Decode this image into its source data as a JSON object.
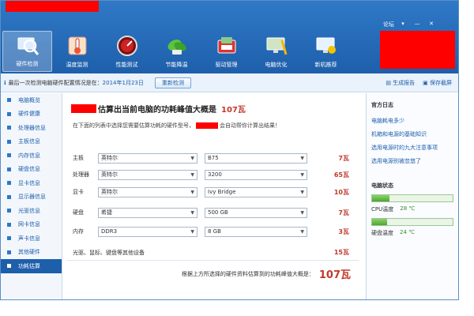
{
  "header": {
    "win_controls": [
      "论坛",
      "▾",
      "—",
      "✕"
    ],
    "toolbar": [
      {
        "label": "硬件检测",
        "icon": "magnifier-computer-icon",
        "active": true
      },
      {
        "label": "温度监测",
        "icon": "thermometer-icon"
      },
      {
        "label": "性能测试",
        "icon": "speed-gauge-icon"
      },
      {
        "label": "节能降温",
        "icon": "leaf-plug-icon"
      },
      {
        "label": "驱动管理",
        "icon": "driver-chip-icon"
      },
      {
        "label": "电脑优化",
        "icon": "monitor-broom-icon"
      },
      {
        "label": "新机推荐",
        "icon": "new-computer-icon"
      }
    ]
  },
  "infobar": {
    "text": "最后一次检测电脑硬件配置情况是在：",
    "date": "2014年1月23日",
    "detect_button": "重新检测",
    "report_link": "生成报告",
    "save_link": "保存截屏"
  },
  "sidebar": {
    "items": [
      {
        "label": "电脑概览"
      },
      {
        "label": "硬件健康"
      },
      {
        "label": "处理器信息"
      },
      {
        "label": "主板信息"
      },
      {
        "label": "内存信息"
      },
      {
        "label": "硬盘信息"
      },
      {
        "label": "显卡信息"
      },
      {
        "label": "显示器信息"
      },
      {
        "label": "光驱信息"
      },
      {
        "label": "网卡信息"
      },
      {
        "label": "声卡信息"
      },
      {
        "label": "其他硬件"
      },
      {
        "label": "功耗估算",
        "active": true
      }
    ]
  },
  "main": {
    "title": "估算出当前电脑的功耗峰值大概是",
    "title_watt": "107瓦",
    "desc_a": "在下面的列表中选择您需要估算功耗的硬件型号，",
    "desc_b": "会自动帮你计算出结果！",
    "rows": [
      {
        "label": "主板",
        "brand": "英特尔",
        "model": "B75",
        "watt": "7瓦"
      },
      {
        "label": "处理器",
        "brand": "英特尔",
        "model": "3200",
        "watt": "65瓦"
      },
      {
        "label": "显卡",
        "brand": "英特尔",
        "model": "Ivy Bridge",
        "watt": "10瓦"
      },
      {
        "label": "硬盘",
        "brand": "希捷",
        "model": "500 GB",
        "watt": "7瓦"
      },
      {
        "label": "内存",
        "brand": "DDR3",
        "model": "8 GB",
        "watt": "3瓦"
      }
    ],
    "other_text": "光驱、鼠标、键盘等其他设备",
    "other_watt": "15瓦",
    "total_text": "根据上方所选择的硬件资料估算到的功耗峰值大概是：",
    "total_watt": "107瓦"
  },
  "rightpanel": {
    "log_title": "官方日志",
    "links": [
      "电脑耗电多少",
      "机箱和电源的基础知识",
      "选用电源时的九大注意事项",
      "选用电源别被忽悠了"
    ],
    "status_title": "电脑状态",
    "cpu": {
      "label": "CPU温度",
      "value": "28 ℃",
      "level": 0.22
    },
    "disk": {
      "label": "硬盘温度",
      "value": "24 ℃",
      "level": 0.19
    }
  },
  "colors": {
    "accent": "#1e5fab",
    "watt": "#c0392b",
    "redaction": "#ff0000"
  }
}
